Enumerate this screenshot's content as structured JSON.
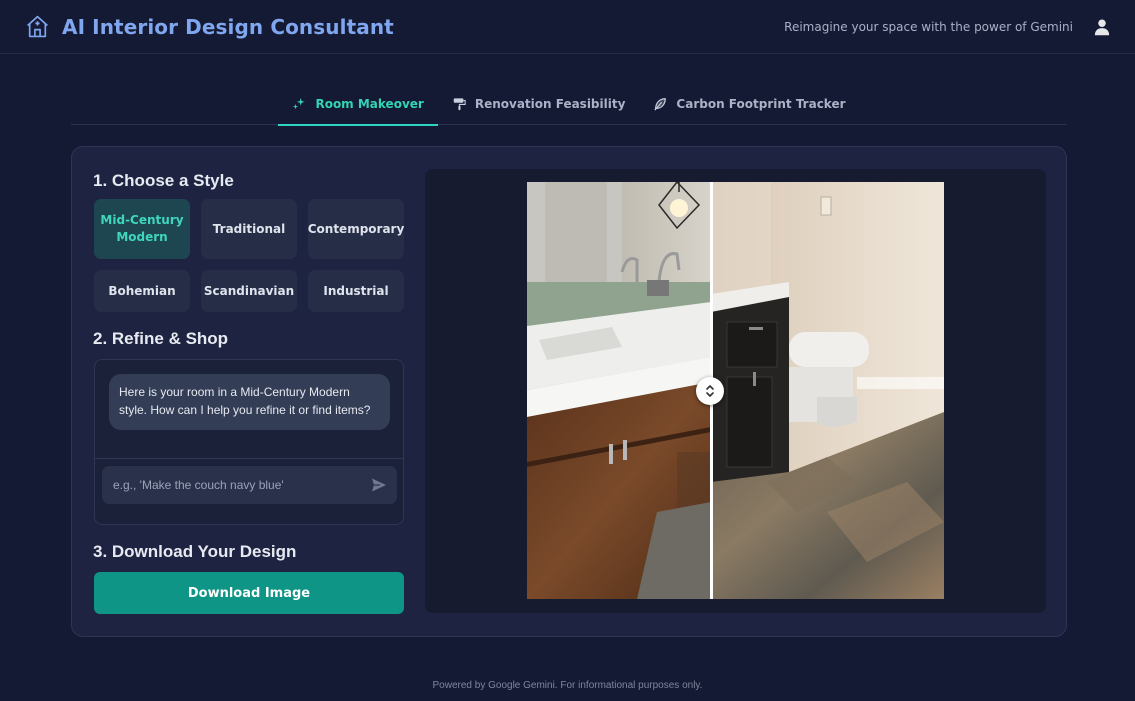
{
  "header": {
    "title": "AI Interior Design Consultant",
    "tagline": "Reimagine your space with the power of Gemini",
    "brand_icon": "house-icon",
    "user_icon": "user-icon"
  },
  "tabs": [
    {
      "label": "Room Makeover",
      "icon": "sparkles-icon",
      "active": true
    },
    {
      "label": "Renovation Feasibility",
      "icon": "paint-roller-icon",
      "active": false
    },
    {
      "label": "Carbon Footprint Tracker",
      "icon": "leaf-icon",
      "active": false
    }
  ],
  "styles": {
    "title": "1. Choose a Style",
    "options": [
      "Mid-Century Modern",
      "Traditional",
      "Contemporary",
      "Bohemian",
      "Scandinavian",
      "Industrial"
    ],
    "selected": "Mid-Century Modern"
  },
  "refine": {
    "title": "2. Refine & Shop",
    "message": "Here is your room in a Mid-Century Modern style. How can I help you refine it or find items?",
    "input_placeholder": "e.g., 'Make the couch navy blue'",
    "input_value": ""
  },
  "download": {
    "title": "3. Download Your Design",
    "button_label": "Download Image"
  },
  "comparison": {
    "slider_position": 0.44
  },
  "footer": {
    "text": "Powered by Google Gemini. For informational purposes only."
  },
  "colors": {
    "accent": "#2dd4bf",
    "primary_button": "#0f9586",
    "brand": "#7fa6ee",
    "background": "#151a34"
  }
}
